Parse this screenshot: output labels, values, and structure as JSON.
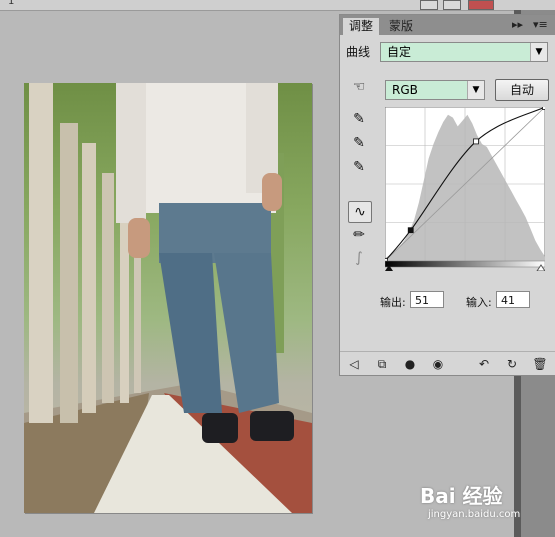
{
  "host": {
    "top_caption": "1"
  },
  "panel": {
    "tabs": [
      {
        "label": "调整"
      },
      {
        "label": "蒙版"
      }
    ],
    "menu_glyphs": {
      "expand": "▸▸",
      "menu": "▾≡"
    },
    "preset_label": "曲线",
    "preset_value": "自定",
    "channel_value": "RGB",
    "auto_label": "自动",
    "output_label": "输出:",
    "output_value": "51",
    "input_label": "输入:",
    "input_value": "41"
  },
  "curve": {
    "points": [
      {
        "input": 0,
        "output": 0
      },
      {
        "input": 41,
        "output": 51
      },
      {
        "input": 145,
        "output": 198
      },
      {
        "input": 255,
        "output": 255
      }
    ],
    "range": [
      0,
      255
    ]
  },
  "colors": {
    "field_green": "#c9ecd6",
    "panel_bg": "#d6d6d6",
    "histogram": "#c2c2c2"
  },
  "icons": {
    "hand": "hand-adjust-icon",
    "black_eyedropper": "black-point-eyedropper-icon",
    "gray_eyedropper": "gray-point-eyedropper-icon",
    "white_eyedropper": "white-point-eyedropper-icon",
    "curve_tool": "curve-point-tool-icon",
    "pencil_tool": "pencil-tool-icon",
    "smooth_tool": "smooth-curve-icon"
  },
  "watermark": {
    "line1": "Bai 经验",
    "line2": "jingyan.baidu.com"
  }
}
